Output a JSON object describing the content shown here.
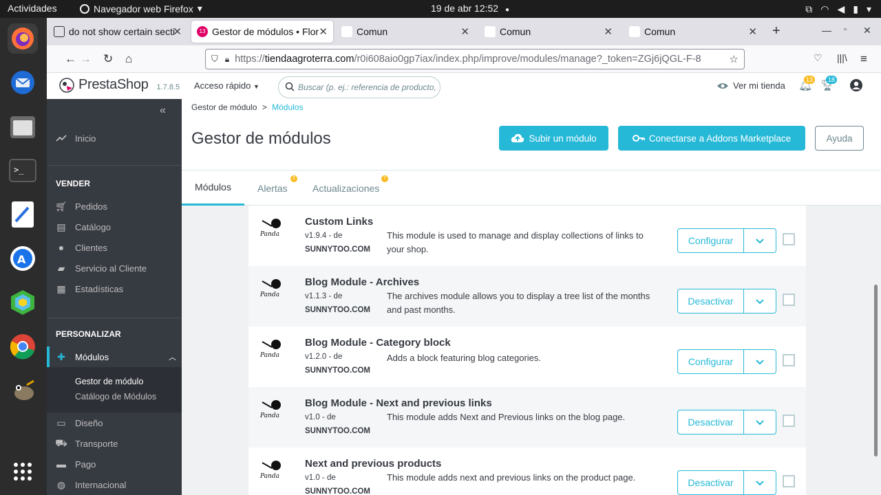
{
  "os": {
    "activities": "Actividades",
    "app_name": "Navegador web Firefox",
    "clock": "19 de abr  12:52"
  },
  "browser": {
    "tabs": [
      {
        "label": "do not show certain secti",
        "active": false
      },
      {
        "label": "Gestor de módulos • Flor",
        "active": true,
        "badge": "13"
      },
      {
        "label": "Comun",
        "active": false
      },
      {
        "label": "Comun",
        "active": false
      },
      {
        "label": "Comun",
        "active": false
      }
    ],
    "url_prefix": "https://",
    "url_host": "tiendaagroterra.com",
    "url_path": "/r0i608aio0gp7iax/index.php/improve/modules/manage?_token=ZGj6jQGL-F-8"
  },
  "header": {
    "logo_name": "PrestaShop",
    "version": "1.7.8.5",
    "quick_access": "Acceso rápido",
    "search_placeholder": "Buscar (p. ej.: referencia de producto,",
    "view_shop": "Ver mi tienda",
    "orders_badge": "13",
    "customers_badge": "18"
  },
  "sidebar": {
    "collapse_icon": "«",
    "home": "Inicio",
    "sell_title": "VENDER",
    "sell_items": [
      "Pedidos",
      "Catálogo",
      "Clientes",
      "Servicio al Cliente",
      "Estadísticas"
    ],
    "customize_title": "PERSONALIZAR",
    "modules": "Módulos",
    "module_subs": [
      "Gestor de módulo",
      "Catálogo de Módulos"
    ],
    "more_items": [
      "Diseño",
      "Transporte",
      "Pago",
      "Internacional"
    ]
  },
  "page": {
    "breadcrumb_parent": "Gestor de módulo",
    "breadcrumb_sep": ">",
    "breadcrumb_current": "Módulos",
    "title": "Gestor de módulos",
    "upload_button": "Subir un módulo",
    "connect_button": "Conectarse a Addons Marketplace",
    "help_button": "Ayuda",
    "tabs": [
      {
        "label": "Módulos",
        "active": true
      },
      {
        "label": "Alertas",
        "badge": "2"
      },
      {
        "label": "Actualizaciones",
        "badge": "7"
      }
    ]
  },
  "modules": [
    {
      "name": "Custom Links",
      "version": "v1.9.4 - de",
      "author": "SUNNYTOO.COM",
      "description": "This module is used to manage and display collections of links to your shop.",
      "action": "Configurar"
    },
    {
      "name": "Blog Module - Archives",
      "version": "v1.1.3 - de",
      "author": "SUNNYTOO.COM",
      "description": "The archives module allows you to display a tree list of the months and past months.",
      "action": "Desactivar"
    },
    {
      "name": "Blog Module - Category block",
      "version": "v1.2.0 - de",
      "author": "SUNNYTOO.COM",
      "description": "Adds a block featuring blog categories.",
      "action": "Configurar"
    },
    {
      "name": "Blog Module - Next and previous links",
      "version": "v1.0 - de",
      "author": "SUNNYTOO.COM",
      "description": "This module adds Next and Previous links on the blog page.",
      "action": "Desactivar"
    },
    {
      "name": "Next and previous products",
      "version": "v1.0 - de",
      "author": "SUNNYTOO.COM",
      "description": "This module adds next and previous links on the product page.",
      "action": "Desactivar"
    }
  ],
  "module_logo_text": "Panda",
  "colors": {
    "accent": "#25b9d7",
    "sidebar": "#363a41",
    "badge": "#fbbb22"
  }
}
